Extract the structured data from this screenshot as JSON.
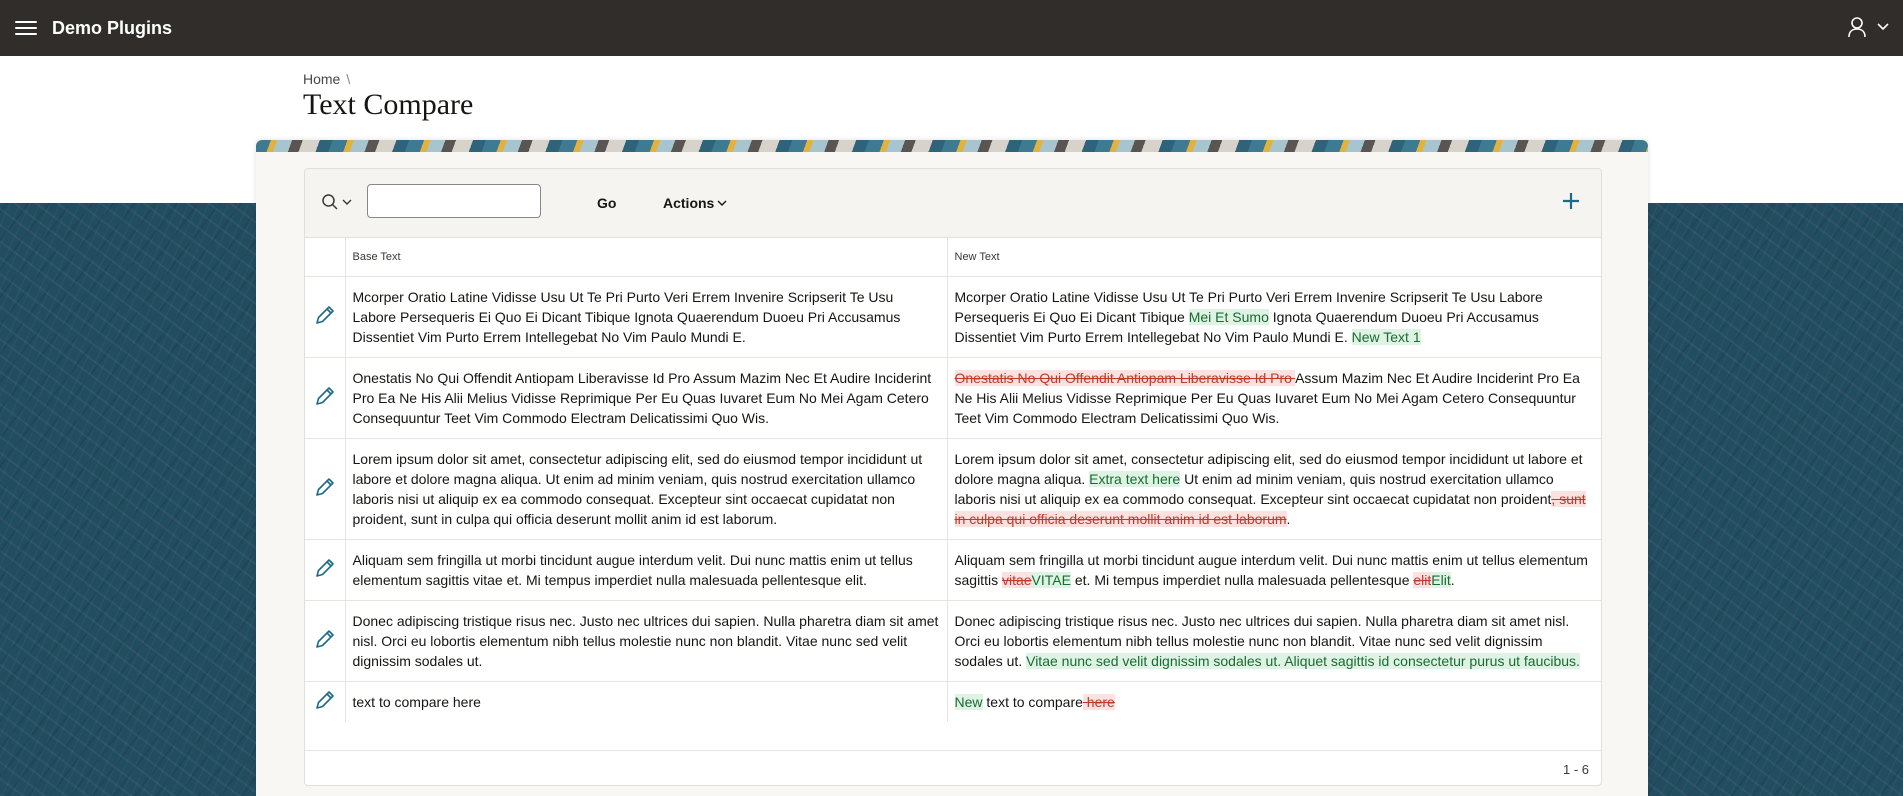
{
  "header": {
    "app_title": "Demo Plugins",
    "menu_icon": "hamburger-menu-icon",
    "user_icon": "user-icon",
    "chevron_icon": "chevron-down-icon",
    "background_color": "#312d2a"
  },
  "breadcrumb": {
    "home": "Home",
    "separator": "\\"
  },
  "page": {
    "title": "Text Compare"
  },
  "toolbar": {
    "search_icon": "search-icon",
    "search_value": "",
    "go_label": "Go",
    "actions_label": "Actions",
    "add_icon": "plus-icon"
  },
  "table": {
    "columns": [
      "Base Text",
      "New Text"
    ],
    "rows": [
      {
        "base": [
          {
            "t": "Mcorper Oratio Latine Vidisse Usu Ut Te Pri Purto Veri Errem Invenire Scripserit Te Usu Labore Persequeris Ei Quo Ei Dicant Tibique Ignota Quaerendum Duoeu Pri Accusamus Dissentiet Vim Purto Errem Intellegebat No Vim Paulo Mundi E."
          }
        ],
        "new": [
          {
            "t": "Mcorper Oratio Latine Vidisse Usu Ut Te Pri Purto Veri Errem Invenire Scripserit Te Usu Labore Persequeris Ei Quo Ei Dicant Tibique "
          },
          {
            "t": "Mei Et Sumo",
            "c": "ins"
          },
          {
            "t": " Ignota Quaerendum Duoeu Pri Accusamus Dissentiet Vim Purto Errem Intellegebat No Vim Paulo Mundi E. "
          },
          {
            "t": "New Text 1",
            "c": "ins"
          }
        ]
      },
      {
        "base": [
          {
            "t": "Onestatis No Qui Offendit Antiopam Liberavisse Id Pro Assum Mazim Nec Et Audire Inciderint Pro Ea Ne His Alii Melius Vidisse Reprimique Per Eu Quas Iuvaret Eum No Mei Agam Cetero Consequuntur Teet Vim Commodo Electram Delicatissimi Quo Wis."
          }
        ],
        "new": [
          {
            "t": "Onestatis No Qui Offendit Antiopam Liberavisse Id Pro ",
            "c": "del"
          },
          {
            "t": "Assum Mazim Nec Et Audire Inciderint Pro Ea Ne His Alii Melius Vidisse Reprimique Per Eu Quas Iuvaret Eum No Mei Agam Cetero Consequuntur Teet Vim Commodo Electram Delicatissimi Quo Wis."
          }
        ]
      },
      {
        "base": [
          {
            "t": "Lorem ipsum dolor sit amet, consectetur adipiscing elit, sed do eiusmod tempor incididunt ut labore et dolore magna aliqua. Ut enim ad minim veniam, quis nostrud exercitation ullamco laboris nisi ut aliquip ex ea commodo consequat. Excepteur sint occaecat cupidatat non proident, sunt in culpa qui officia deserunt mollit anim id est laborum."
          }
        ],
        "new": [
          {
            "t": "Lorem ipsum dolor sit amet, consectetur adipiscing elit, sed do eiusmod tempor incididunt ut labore et dolore magna aliqua. "
          },
          {
            "t": "Extra text here",
            "c": "ins"
          },
          {
            "t": " Ut enim ad minim veniam, quis nostrud exercitation ullamco laboris nisi ut aliquip ex ea commodo consequat. Excepteur sint occaecat cupidatat non proident"
          },
          {
            "t": ", sunt in culpa qui officia deserunt mollit anim id est laborum",
            "c": "del"
          },
          {
            "t": "."
          }
        ]
      },
      {
        "base": [
          {
            "t": "Aliquam sem fringilla ut morbi tincidunt augue interdum velit. Dui nunc mattis enim ut tellus elementum sagittis vitae et. Mi tempus imperdiet nulla malesuada pellentesque elit."
          }
        ],
        "new": [
          {
            "t": "Aliquam sem fringilla ut morbi tincidunt augue interdum velit. Dui nunc mattis enim ut tellus elementum sagittis "
          },
          {
            "t": "vitae",
            "c": "del"
          },
          {
            "t": "VITAE",
            "c": "ins"
          },
          {
            "t": " et. Mi tempus imperdiet nulla malesuada pellentesque "
          },
          {
            "t": "elit",
            "c": "del"
          },
          {
            "t": "Elit",
            "c": "ins"
          },
          {
            "t": "."
          }
        ]
      },
      {
        "base": [
          {
            "t": "Donec adipiscing tristique risus nec. Justo nec ultrices dui sapien. Nulla pharetra diam sit amet nisl. Orci eu lobortis elementum nibh tellus molestie nunc non blandit. Vitae nunc sed velit dignissim sodales ut."
          }
        ],
        "new": [
          {
            "t": "Donec adipiscing tristique risus nec. Justo nec ultrices dui sapien. Nulla pharetra diam sit amet nisl. Orci eu lobortis elementum nibh tellus molestie nunc non blandit. Vitae nunc sed velit dignissim sodales ut. "
          },
          {
            "t": "Vitae nunc sed velit dignissim sodales ut. Aliquet sagittis id consectetur purus ut faucibus.",
            "c": "ins"
          }
        ]
      },
      {
        "base": [
          {
            "t": "text to compare here"
          }
        ],
        "new": [
          {
            "t": "New",
            "c": "ins"
          },
          {
            "t": " text to compare"
          },
          {
            "t": " here",
            "c": "del"
          }
        ]
      }
    ]
  },
  "pagination": "1 - 6",
  "colors": {
    "accent": "#1c6a8a",
    "insert_bg": "#dff3e4",
    "delete_fg": "#c0392b",
    "band_bg": "#224c60"
  }
}
